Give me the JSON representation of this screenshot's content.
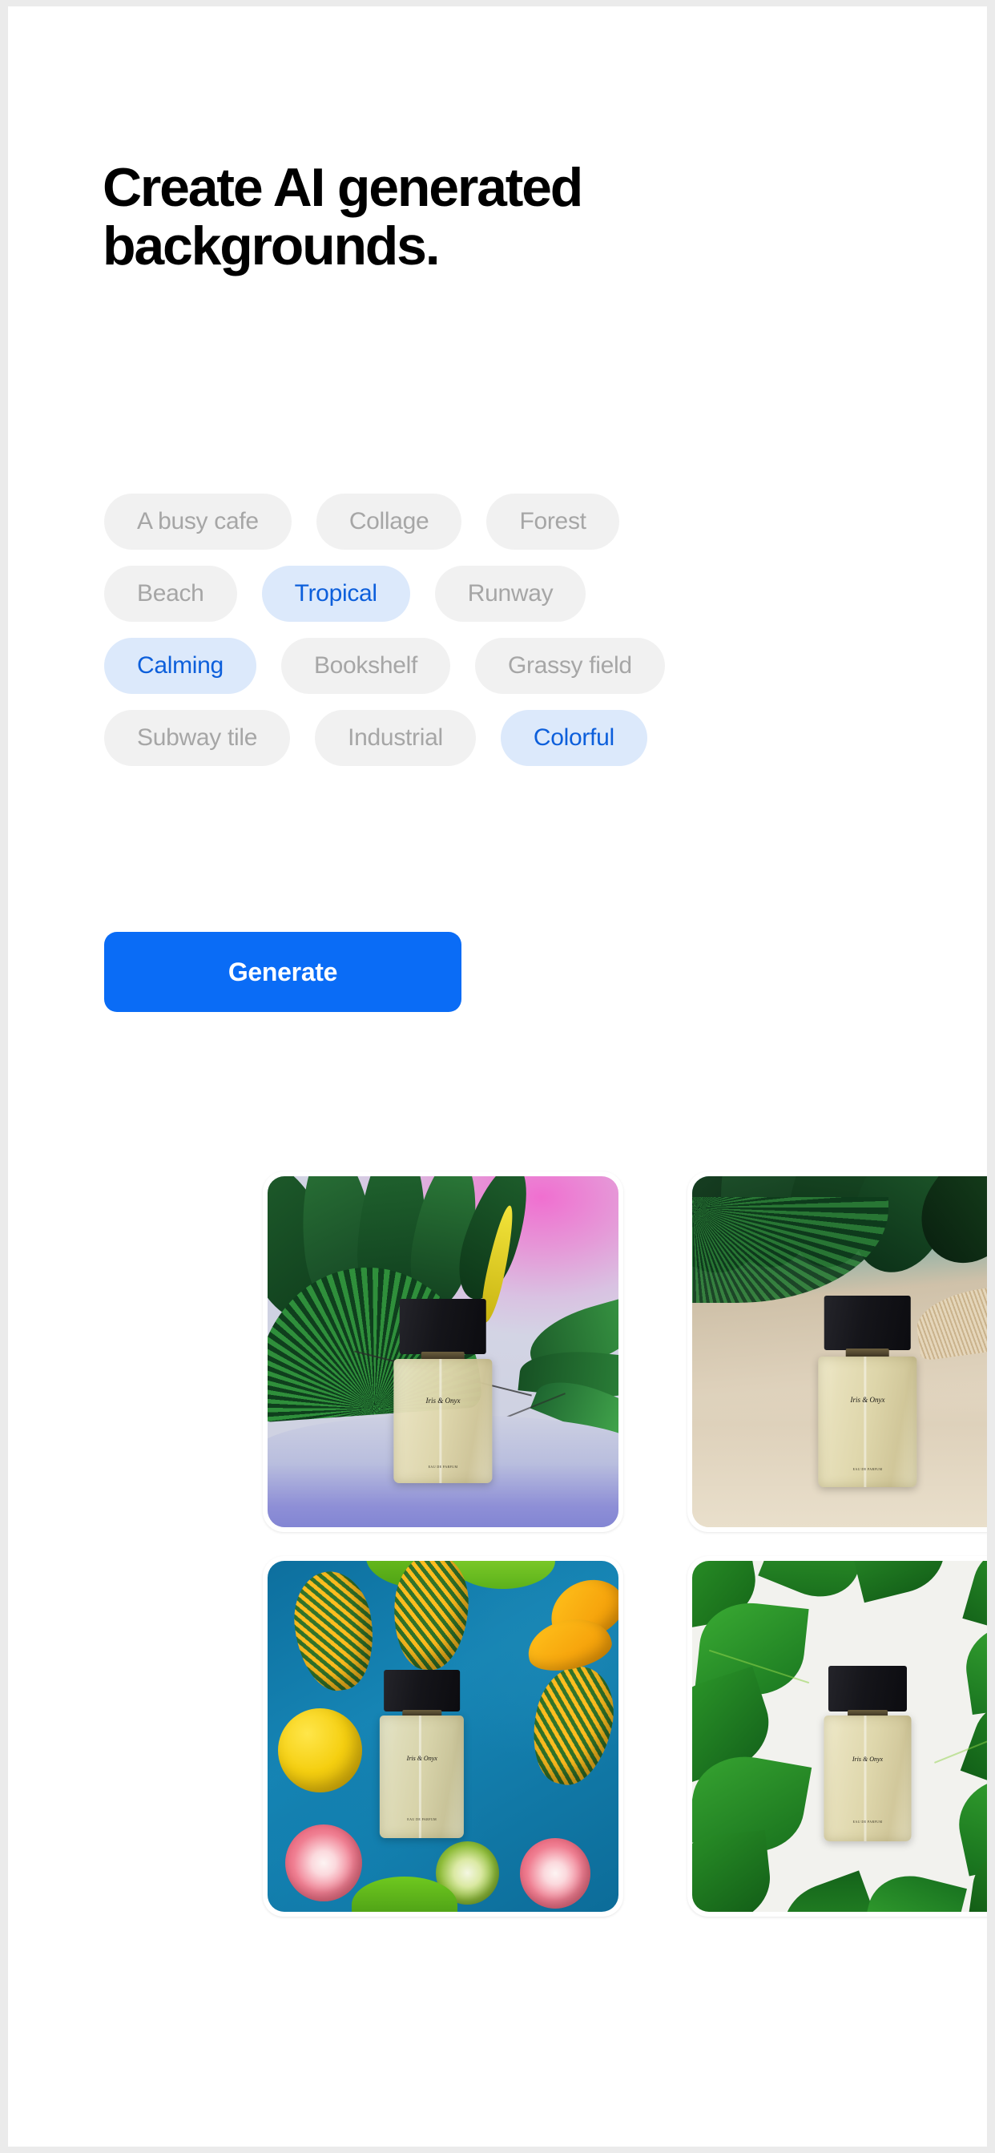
{
  "page": {
    "background_color": "#ebebeb",
    "card_color": "#ffffff"
  },
  "headline": {
    "line1": "Create AI generated",
    "line2": "backgrounds.",
    "full": "Create AI generated backgrounds.",
    "color": "#000000"
  },
  "chips": {
    "unselected_bg": "#f1f1f1",
    "unselected_text": "#a6a6a6",
    "selected_bg": "#dce9fb",
    "selected_text": "#0d5fdb",
    "rows": [
      [
        {
          "label": "A busy cafe",
          "selected": false
        },
        {
          "label": "Collage",
          "selected": false
        },
        {
          "label": "Forest",
          "selected": false
        }
      ],
      [
        {
          "label": "Beach",
          "selected": false
        },
        {
          "label": "Tropical",
          "selected": true
        },
        {
          "label": "Runway",
          "selected": false
        }
      ],
      [
        {
          "label": "Calming",
          "selected": true
        },
        {
          "label": "Bookshelf",
          "selected": false
        },
        {
          "label": "Grassy field",
          "selected": false
        }
      ],
      [
        {
          "label": "Subway tile",
          "selected": false
        },
        {
          "label": "Industrial",
          "selected": false
        },
        {
          "label": "Colorful",
          "selected": true
        }
      ]
    ]
  },
  "generate_button": {
    "label": "Generate",
    "bg": "#0a6cf6",
    "text_color": "#ffffff"
  },
  "results": {
    "product_label": "Iris & Onyx",
    "items": [
      {
        "scene": "pink-gradient-palm-leaves",
        "description": "Perfume bottle on white pedestal with tropical palm leaves against pink to lavender gradient backdrop"
      },
      {
        "scene": "sand-dune-palm-leaves",
        "description": "Perfume bottle on beige sand with dark palm fronds and teal sky"
      },
      {
        "scene": "blue-tropical-fruit-flatlay",
        "description": "Perfume bottle flatlay on blue surface surrounded by pineapples, lemon, mango slices and dragon fruit"
      },
      {
        "scene": "green-leaves-white",
        "description": "Perfume bottle centered on white surface framed by bright green tropical leaves"
      }
    ]
  }
}
